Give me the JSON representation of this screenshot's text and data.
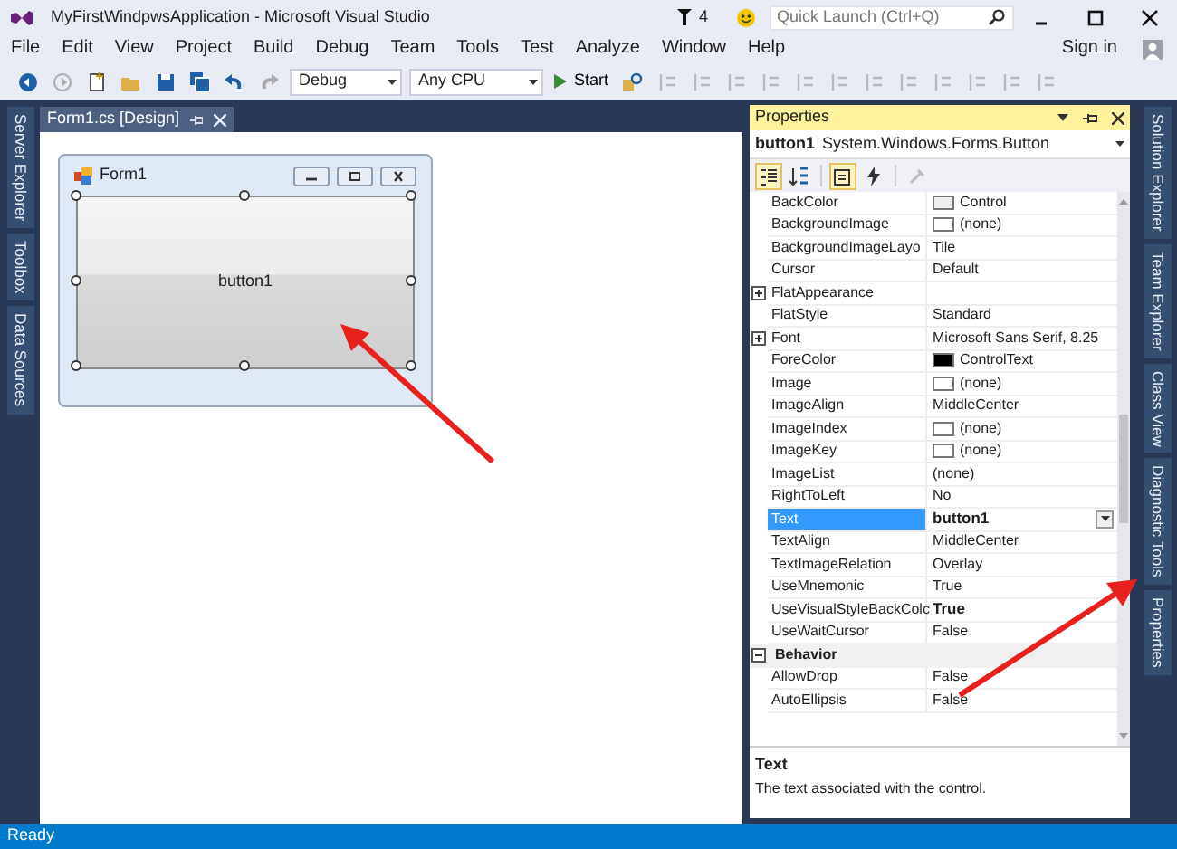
{
  "window": {
    "title": "MyFirstWindpwsApplication - Microsoft Visual Studio",
    "notification_count": "4",
    "quick_launch": {
      "placeholder": "Quick Launch (Ctrl+Q)"
    }
  },
  "menu": [
    "File",
    "Edit",
    "View",
    "Project",
    "Build",
    "Debug",
    "Team",
    "Tools",
    "Test",
    "Analyze",
    "Window",
    "Help"
  ],
  "account": {
    "label": "Sign in"
  },
  "toolbar": {
    "configuration": "Debug",
    "platform": "Any CPU",
    "start": "Start"
  },
  "left_tabs": [
    "Server Explorer",
    "Toolbox",
    "Data Sources"
  ],
  "document_tabs": [
    {
      "label": "Form1.cs [Design]",
      "selected": true
    }
  ],
  "form": {
    "title": "Form1",
    "button": {
      "label": "button1",
      "selected": true
    }
  },
  "properties": {
    "title": "Properties",
    "object_name": "button1",
    "object_type": "System.Windows.Forms.Button",
    "toolbar": [
      {
        "kind": "categorized",
        "selected": true
      },
      {
        "kind": "alphabetical",
        "selected": false
      },
      {
        "kind": "properties",
        "selected": true
      },
      {
        "kind": "events",
        "selected": false
      },
      {
        "kind": "pages",
        "selected": false
      }
    ],
    "rows": [
      {
        "kind": "property",
        "name": "BackColor",
        "value": "Control",
        "color": "#f0f0f0",
        "bold": false,
        "selected": false
      },
      {
        "kind": "property",
        "name": "BackgroundImage",
        "value": "(none)",
        "color": "#ffffff",
        "bold": false,
        "selected": false
      },
      {
        "kind": "property",
        "name": "BackgroundImageLayo",
        "value": "Tile",
        "bold": false,
        "selected": false
      },
      {
        "kind": "property",
        "name": "Cursor",
        "value": "Default",
        "bold": false,
        "selected": false
      },
      {
        "kind": "property",
        "name": "FlatAppearance",
        "expanded": false,
        "selected": false
      },
      {
        "kind": "property",
        "name": "FlatStyle",
        "value": "Standard",
        "bold": false,
        "selected": false
      },
      {
        "kind": "property",
        "name": "Font",
        "value": "Microsoft Sans Serif, 8.25",
        "expanded": false,
        "bold": false,
        "selected": false
      },
      {
        "kind": "property",
        "name": "ForeColor",
        "value": "ControlText",
        "color": "#000000",
        "bold": false,
        "selected": false
      },
      {
        "kind": "property",
        "name": "Image",
        "value": "(none)",
        "color": "#ffffff",
        "bold": false,
        "selected": false
      },
      {
        "kind": "property",
        "name": "ImageAlign",
        "value": "MiddleCenter",
        "bold": false,
        "selected": false
      },
      {
        "kind": "property",
        "name": "ImageIndex",
        "value": "(none)",
        "color": "#ffffff",
        "bold": false,
        "selected": false
      },
      {
        "kind": "property",
        "name": "ImageKey",
        "value": "(none)",
        "color": "#ffffff",
        "bold": false,
        "selected": false
      },
      {
        "kind": "property",
        "name": "ImageList",
        "value": "(none)",
        "bold": false,
        "selected": false
      },
      {
        "kind": "property",
        "name": "RightToLeft",
        "value": "No",
        "bold": false,
        "selected": false
      },
      {
        "kind": "property",
        "name": "Text",
        "value": "button1",
        "bold": true,
        "selected": true
      },
      {
        "kind": "property",
        "name": "TextAlign",
        "value": "MiddleCenter",
        "bold": false,
        "selected": false
      },
      {
        "kind": "property",
        "name": "TextImageRelation",
        "value": "Overlay",
        "bold": false,
        "selected": false
      },
      {
        "kind": "property",
        "name": "UseMnemonic",
        "value": "True",
        "bold": false,
        "selected": false
      },
      {
        "kind": "property",
        "name": "UseVisualStyleBackColc",
        "value": "True",
        "bold": true,
        "selected": false
      },
      {
        "kind": "property",
        "name": "UseWaitCursor",
        "value": "False",
        "bold": false,
        "selected": false
      },
      {
        "kind": "category",
        "name": "Behavior",
        "expanded": true
      },
      {
        "kind": "property",
        "name": "AllowDrop",
        "value": "False",
        "bold": false,
        "selected": false
      },
      {
        "kind": "property",
        "name": "AutoEllipsis",
        "value": "False",
        "bold": false,
        "selected": false
      }
    ],
    "description": {
      "title": "Text",
      "text": "The text associated with the control."
    }
  },
  "right_tabs": [
    "Solution Explorer",
    "Team Explorer",
    "Class View",
    "Diagnostic Tools",
    "Properties"
  ],
  "status_bar": "Ready"
}
